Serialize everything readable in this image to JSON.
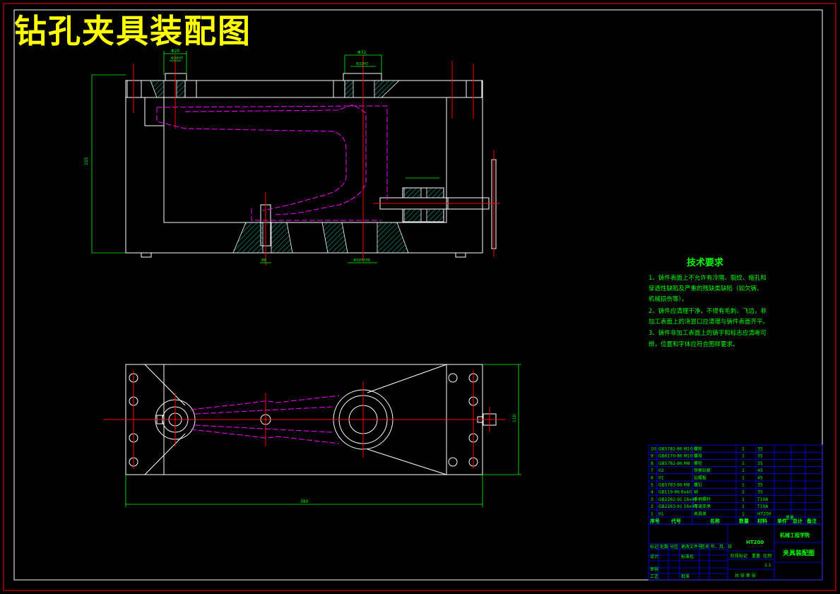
{
  "title": "钻孔夹具装配图",
  "colors": {
    "background": "#000000",
    "outline": "#ffffff",
    "centerline": "#ff0000",
    "hidden_part": "#ff00ff",
    "dimension": "#00ff00",
    "hatch": "#00aa99",
    "title_text": "#ffff00",
    "frame_border": "#ff0000"
  },
  "tech_requirements": {
    "heading": "技术要求",
    "lines": [
      "1、铸件表面上不允许有冷隔、裂纹、缩孔和",
      "穿透性缺陷及严重的残缺类缺陷（如欠铸、",
      "机械损伤等）。",
      "2、铸件应清理干净，不得有毛刺、飞边，非",
      "加工表面上的浇冒口应清理与铸件表面齐平。",
      "3、铸件非加工表面上的铸字和标志应清晰可",
      "辨，位置和字体应符合图样要求。"
    ]
  },
  "parts_table": {
    "header": [
      "序号",
      "代号",
      "名称",
      "数量",
      "材料",
      "单件",
      "总计",
      "备注"
    ],
    "header_extra": "重量",
    "rows": [
      [
        "10",
        "GB5782-86 M10",
        "螺栓",
        "1",
        "35",
        ""
      ],
      [
        "9",
        "GB6170-86 M10",
        "螺母",
        "1",
        "35",
        ""
      ],
      [
        "8",
        "GB5782-86 M8",
        "螺栓",
        "1",
        "35",
        ""
      ],
      [
        "7",
        "02",
        "快换钻套",
        "1",
        "45",
        ""
      ],
      [
        "6",
        "01",
        "钻模板",
        "1",
        "45",
        ""
      ],
      [
        "5",
        "GB5783-86 M8",
        "螺钉",
        "1",
        "35",
        ""
      ],
      [
        "4",
        "GB119-86 8x40",
        "销",
        "2",
        "35",
        ""
      ],
      [
        "3",
        "GB2262-91 16x40",
        "手柄螺杆",
        "1",
        "T10A",
        ""
      ],
      [
        "2",
        "GB2263-91 16x40",
        "可调支承",
        "1",
        "T10A",
        ""
      ],
      [
        "1",
        "01",
        "夹具体",
        "1",
        "HT200",
        ""
      ]
    ]
  },
  "title_block": {
    "school": "机械工程学院",
    "drawing_name": "夹具装配图",
    "material_mark": "HT200",
    "labels": [
      "标记",
      "处数",
      "分区",
      "更改文件号",
      "签名",
      "年、月、日"
    ],
    "labels2": [
      "设计",
      "标准化"
    ],
    "labels3": [
      "审核"
    ],
    "labels4": [
      "工艺",
      "批准"
    ],
    "stage_labels": [
      "阶段标记",
      "重量",
      "比例"
    ],
    "scale": "1:1",
    "sheet_info": "共 张 第 张"
  },
  "dimension_labels": {
    "height": "155",
    "length": "380",
    "width": "110",
    "bore_top_left": "Φ20",
    "bore_top_right": "Φ32",
    "fit_top_left": "Φ20H7",
    "fit_top_right": "Φ32H7",
    "pin": "Φ8",
    "base_bore": "Φ32H7/f6"
  }
}
